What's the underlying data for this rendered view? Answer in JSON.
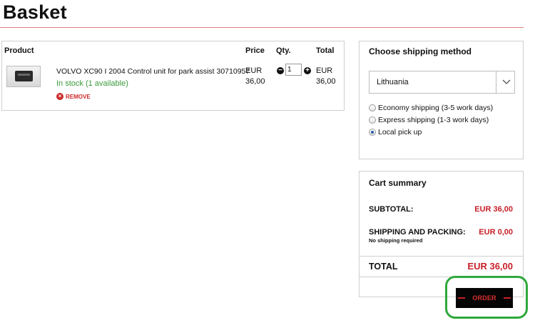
{
  "page": {
    "title": "Basket"
  },
  "table": {
    "headers": {
      "product": "Product",
      "price": "Price",
      "qty": "Qty.",
      "total": "Total"
    },
    "items": [
      {
        "name": "VOLVO XC90 I 2004 Control unit for park assist 30710957",
        "stock": "In stock (1 available)",
        "remove_label": "REMOVE",
        "price_currency": "EUR",
        "price_amount": "36,00",
        "quantity": "1",
        "total_currency": "EUR",
        "total_amount": "36,00"
      }
    ]
  },
  "shipping": {
    "title": "Choose shipping method",
    "country": "Lithuania",
    "options": [
      {
        "label": "Economy shipping (3-5 work days)",
        "selected": false
      },
      {
        "label": "Express shipping (1-3 work days)",
        "selected": false
      },
      {
        "label": "Local pick up",
        "selected": true
      }
    ]
  },
  "summary": {
    "title": "Cart summary",
    "subtotal_label": "SUBTOTAL:",
    "subtotal_value": "EUR 36,00",
    "shipping_label": "SHIPPING AND PACKING:",
    "shipping_value": "EUR 0,00",
    "shipping_note": "No shipping required",
    "total_label": "TOTAL",
    "total_value": "EUR 36,00"
  },
  "actions": {
    "order_label": "ORDER"
  },
  "icons": {
    "remove": "close-circle-icon",
    "minus": "minus-circle-icon",
    "plus": "plus-circle-icon",
    "dropdown": "chevron-down-icon"
  },
  "colors": {
    "accent_red": "#c8202a",
    "stock_green": "#3a9a3a",
    "highlight_green": "#2fa83c",
    "order_button_bg": "#050505"
  }
}
